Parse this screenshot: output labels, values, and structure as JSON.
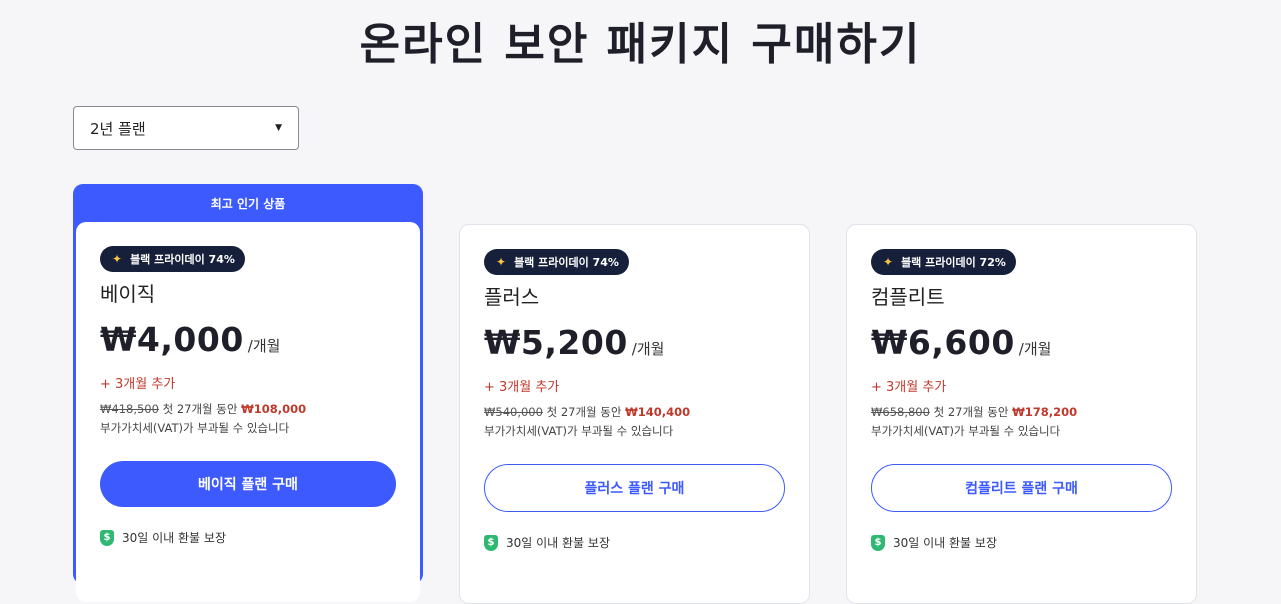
{
  "page": {
    "title": "온라인 보안 패키지 구매하기"
  },
  "plan_select": {
    "value": "2년 플랜"
  },
  "popular_label": "최고 인기 상품",
  "colors": {
    "accent": "#3d5afe",
    "badge_bg": "#17203a",
    "sale": "#c0392b",
    "shield": "#2eb872"
  },
  "cards": [
    {
      "badge": "블랙 프라이데이 74%",
      "name": "베이직",
      "price": "₩4,000",
      "per": "/개월",
      "bonus": "+ 3개월 추가",
      "original": "₩418,500",
      "detail_mid": "첫 27개월 동안",
      "sale": "₩108,000",
      "vat": "부가가치세(VAT)가 부과될 수 있습니다",
      "button": "베이직 플랜 구매",
      "guarantee": "30일 이내 환불 보장"
    },
    {
      "badge": "블랙 프라이데이 74%",
      "name": "플러스",
      "price": "₩5,200",
      "per": "/개월",
      "bonus": "+ 3개월 추가",
      "original": "₩540,000",
      "detail_mid": "첫 27개월 동안",
      "sale": "₩140,400",
      "vat": "부가가치세(VAT)가 부과될 수 있습니다",
      "button": "플러스 플랜 구매",
      "guarantee": "30일 이내 환불 보장"
    },
    {
      "badge": "블랙 프라이데이 72%",
      "name": "컴플리트",
      "price": "₩6,600",
      "per": "/개월",
      "bonus": "+ 3개월 추가",
      "original": "₩658,800",
      "detail_mid": "첫 27개월 동안",
      "sale": "₩178,200",
      "vat": "부가가치세(VAT)가 부과될 수 있습니다",
      "button": "컴플리트 플랜 구매",
      "guarantee": "30일 이내 환불 보장"
    }
  ]
}
